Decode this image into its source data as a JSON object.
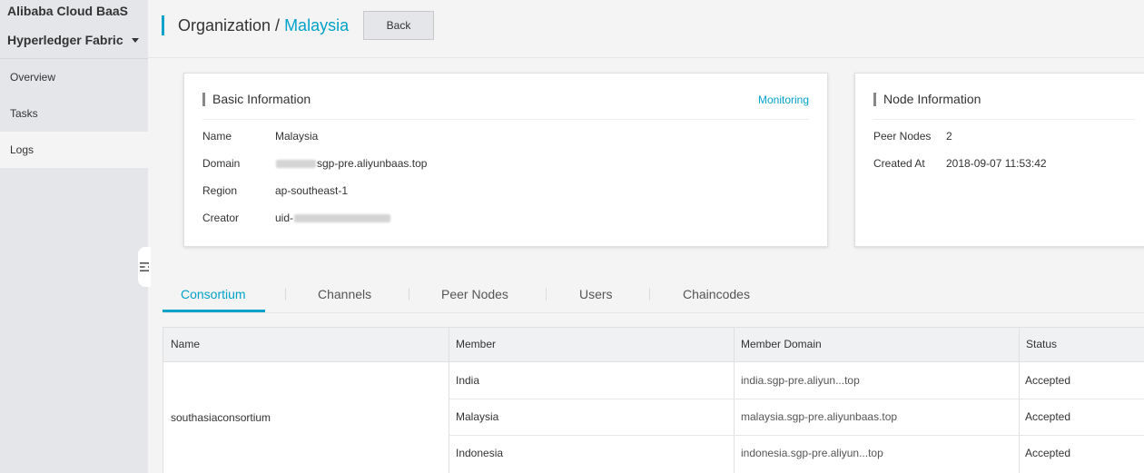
{
  "app": {
    "brand": "Alibaba Cloud BaaS",
    "product": "Hyperledger Fabric"
  },
  "sidebar": {
    "items": [
      {
        "label": "Overview"
      },
      {
        "label": "Tasks"
      },
      {
        "label": "Logs"
      }
    ]
  },
  "header": {
    "title_prefix": "Organization / ",
    "title_current": "Malaysia",
    "back_label": "Back"
  },
  "basic_info": {
    "title": "Basic Information",
    "monitoring_label": "Monitoring",
    "rows": [
      {
        "key": "Name",
        "value": "Malaysia"
      },
      {
        "key": "Domain",
        "value": "sgp-pre.aliyunbaas.top",
        "redacted_prefix": true
      },
      {
        "key": "Region",
        "value": "ap-southeast-1"
      },
      {
        "key": "Creator",
        "value": "uid-",
        "redacted_suffix": true
      }
    ]
  },
  "node_info": {
    "title": "Node Information",
    "rows": [
      {
        "key": "Peer Nodes",
        "value": "2"
      },
      {
        "key": "Created At",
        "value": "2018-09-07 11:53:42"
      }
    ]
  },
  "tabs": [
    {
      "label": "Consortium",
      "active": true
    },
    {
      "label": "Channels"
    },
    {
      "label": "Peer Nodes"
    },
    {
      "label": "Users"
    },
    {
      "label": "Chaincodes"
    }
  ],
  "table": {
    "columns": [
      "Name",
      "Member",
      "Member Domain",
      "Status"
    ],
    "group_name": "southasiaconsortium",
    "rows": [
      {
        "member": "India",
        "domain": "india.sgp-pre.aliyun...top",
        "status": "Accepted"
      },
      {
        "member": "Malaysia",
        "domain": "malaysia.sgp-pre.aliyunbaas.top",
        "status": "Accepted"
      },
      {
        "member": "Indonesia",
        "domain": "indonesia.sgp-pre.aliyun...top",
        "status": "Accepted"
      }
    ]
  },
  "colors": {
    "accent": "#00a2ca",
    "sidebar_bg": "#e4e6ea",
    "page_bg": "#f4f4f4"
  }
}
